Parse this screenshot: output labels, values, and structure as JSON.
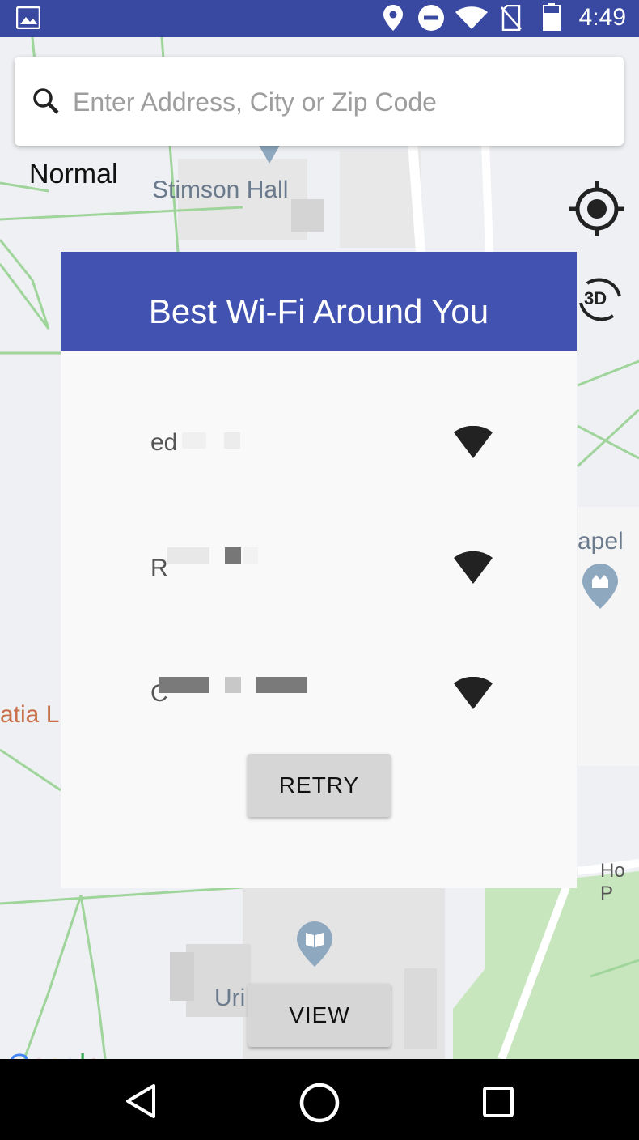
{
  "status_bar": {
    "time": "4:49",
    "icons": [
      "image-icon",
      "location-icon",
      "dnd-icon",
      "wifi-icon",
      "no-sim-icon",
      "battery-icon"
    ]
  },
  "search": {
    "placeholder": "Enter Address, City or Zip Code",
    "value": ""
  },
  "map": {
    "map_type_label": "Normal",
    "labels": {
      "stimson": "Stimson Hall",
      "chapel": "apel",
      "left": "atia L",
      "ho": "Ho P",
      "uris": "Uri"
    },
    "buttons": {
      "three_d": "3D"
    },
    "attribution": {
      "letters": [
        "G",
        "o",
        "o",
        "g",
        "l",
        "e"
      ],
      "colors": [
        "#4285F4",
        "#EA4335",
        "#FBBC05",
        "#4285F4",
        "#34A853",
        "#EA4335"
      ]
    }
  },
  "dialog": {
    "title": "Best Wi-Fi Around You",
    "networks": [
      {
        "name_prefix": "ed",
        "signal": "full"
      },
      {
        "name_prefix": "R",
        "signal": "full"
      },
      {
        "name_prefix": "C",
        "signal": "full"
      }
    ],
    "retry_label": "RETRY"
  },
  "view_label": "VIEW",
  "nav_bar": {
    "icons": [
      "back-icon",
      "home-icon",
      "recents-icon"
    ]
  },
  "colors": {
    "status_bar": "#3948a0",
    "dialog_header": "#4252b0",
    "map_bg": "#eef0f3",
    "park": "#c8e6bd",
    "road": "#9fd49a"
  }
}
